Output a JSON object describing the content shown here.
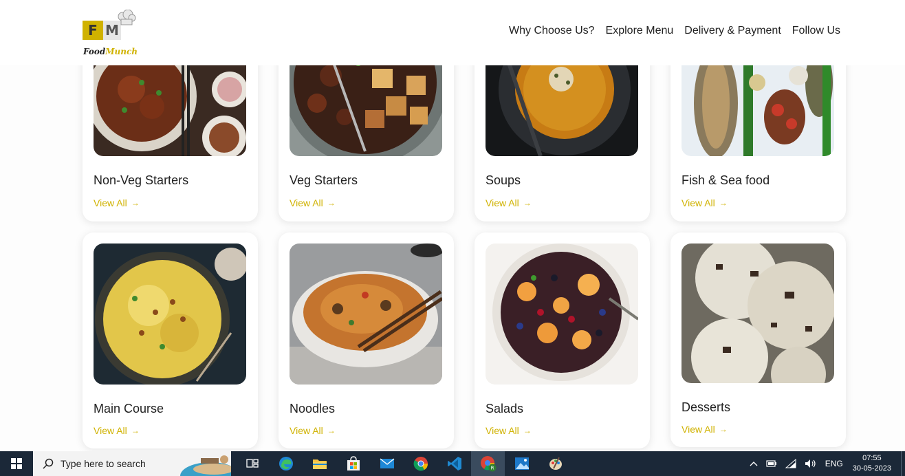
{
  "brand": {
    "logo_f": "F",
    "logo_m": "M",
    "name_food": "Food",
    "name_munch": "Munch"
  },
  "nav": [
    "Why Choose Us?",
    "Explore Menu",
    "Delivery & Payment",
    "Follow Us"
  ],
  "categories": [
    {
      "title": "Non-Veg Starters",
      "link": "View All"
    },
    {
      "title": "Veg Starters",
      "link": "View All"
    },
    {
      "title": "Soups",
      "link": "View All"
    },
    {
      "title": "Fish & Sea food",
      "link": "View All"
    },
    {
      "title": "Main Course",
      "link": "View All"
    },
    {
      "title": "Noodles",
      "link": "View All"
    },
    {
      "title": "Salads",
      "link": "View All"
    },
    {
      "title": "Desserts",
      "link": "View All"
    }
  ],
  "arrow": "→",
  "taskbar": {
    "search_placeholder": "Type here to search",
    "language": "ENG",
    "time": "07:55",
    "date": "30-05-2023"
  },
  "colors": {
    "accent": "#d0b200",
    "taskbar": "#1b2838"
  }
}
